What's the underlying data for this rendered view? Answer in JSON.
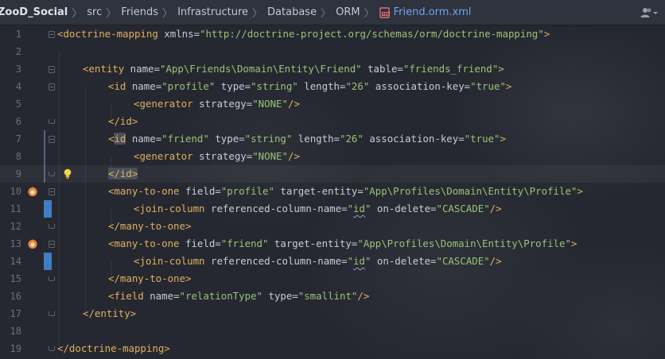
{
  "breadcrumb": {
    "items": [
      "ZooD_Social",
      "src",
      "Friends",
      "Infrastructure",
      "Database",
      "ORM"
    ],
    "file": "Friend.orm.xml",
    "file_icon": "xml-file-icon"
  },
  "toolbar": {
    "user_icon": "user-account-icon"
  },
  "editor": {
    "line_numbers": [
      "1",
      "2",
      "3",
      "4",
      "5",
      "6",
      "7",
      "8",
      "9",
      "10",
      "11",
      "12",
      "13",
      "14",
      "15",
      "16",
      "17",
      "18",
      "19"
    ],
    "colors": {
      "tag": "#e0b060",
      "string": "#98c379",
      "attr": "#c8ccd4",
      "change_marker": "#3d7fc2"
    }
  },
  "code": {
    "l1": {
      "open": "<doctrine-mapping",
      "a1": " xmlns",
      "v1": "\"http://doctrine-project.org/schemas/orm/doctrine-mapping\"",
      "close": ">"
    },
    "l3": {
      "open": "<entity",
      "a1": " name",
      "v1": "\"App\\Friends\\Domain\\Entity\\Friend\"",
      "a2": " table",
      "v2": "\"friends_friend\"",
      "close": ">"
    },
    "l4": {
      "open": "<id",
      "a1": " name",
      "v1": "\"profile\"",
      "a2": " type",
      "v2": "\"string\"",
      "a3": " length",
      "v3": "\"26\"",
      "a4": " association-key",
      "v4": "\"true\"",
      "close": ">"
    },
    "l5": {
      "open": "<generator",
      "a1": " strategy",
      "v1": "\"NONE\"",
      "close": "/>"
    },
    "l6": {
      "text": "</id>"
    },
    "l7": {
      "lt": "<",
      "name": "id",
      "a1": " name",
      "v1": "\"friend\"",
      "a2": " type",
      "v2": "\"string\"",
      "a3": " length",
      "v3": "\"26\"",
      "a4": " association-key",
      "v4": "\"true\"",
      "close": ">"
    },
    "l8": {
      "open": "<generator",
      "a1": " strategy",
      "v1": "\"NONE\"",
      "close": "/>"
    },
    "l9": {
      "text": "</id>"
    },
    "l10": {
      "open": "<many-to-one",
      "a1": " field",
      "v1": "\"profile\"",
      "a2": " target-entity",
      "v2": "\"App\\Profiles\\Domain\\Entity\\Profile\"",
      "close": ">"
    },
    "l11": {
      "open": "<join-column",
      "a1": " referenced-column-name",
      "q1": "\"",
      "v1": "id",
      "q2": "\"",
      "a2": " on-delete",
      "v2": "\"CASCADE\"",
      "close": "/>"
    },
    "l12": {
      "text": "</many-to-one>"
    },
    "l13": {
      "open": "<many-to-one",
      "a1": " field",
      "v1": "\"friend\"",
      "a2": " target-entity",
      "v2": "\"App\\Profiles\\Domain\\Entity\\Profile\"",
      "close": ">"
    },
    "l14": {
      "open": "<join-column",
      "a1": " referenced-column-name",
      "q1": "\"",
      "v1": "id",
      "q2": "\"",
      "a2": " on-delete",
      "v2": "\"CASCADE\"",
      "close": "/>"
    },
    "l15": {
      "text": "</many-to-one>"
    },
    "l16": {
      "open": "<field",
      "a1": " name",
      "v1": "\"relationType\"",
      "a2": " type",
      "v2": "\"smallint\"",
      "close": "/>"
    },
    "l17": {
      "text": "</entity>"
    },
    "l19": {
      "text": "</doctrine-mapping>"
    }
  }
}
